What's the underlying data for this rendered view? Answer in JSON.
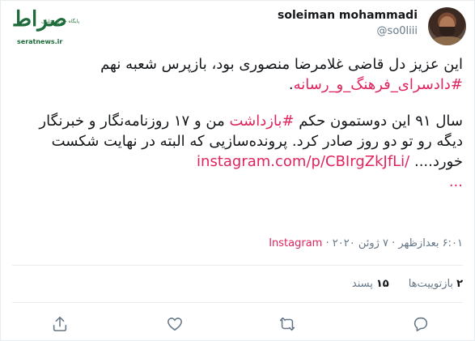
{
  "watermark": {
    "logo_text": "صراط",
    "tagline": "پایگاه خبری تحلیلی",
    "url": "seratnews.ir"
  },
  "author": {
    "name": "soleiman mohammadi",
    "handle": "@so0liii"
  },
  "tweet": {
    "p1_text": "این عزیز دل قاضی غلامرضا منصوری بود، بازپرس شعبه نهم ",
    "p1_hashtag": "#دادسرای_فرهنگ_و_رسانه",
    "p1_end": ".",
    "p2_a": "سال ۹۱ این دوستمون حکم ",
    "p2_hashtag": "#بازداشت",
    "p2_b": " من و ۱۷ روزنامه‌نگار و خبرنگار دیگه رو تو دو روز صادر کرد. پرونده‌سازیی که البته در نهایت شکست خورد.... ",
    "p2_link": "instagram.com/p/CBIrgZkJfLi/",
    "p2_more": "..."
  },
  "meta": {
    "time_date": "۶:۰۱ بعدازظهر · ۷ ژوئن ۲۰۲۰ · ",
    "source": "Instagram"
  },
  "stats": {
    "retweets_count": "۲",
    "retweets_label": "بازتوییت‌ها",
    "likes_count": "۱۵",
    "likes_label": "پسند"
  },
  "actions": [
    "reply-icon",
    "retweet-icon",
    "like-icon",
    "share-icon"
  ]
}
